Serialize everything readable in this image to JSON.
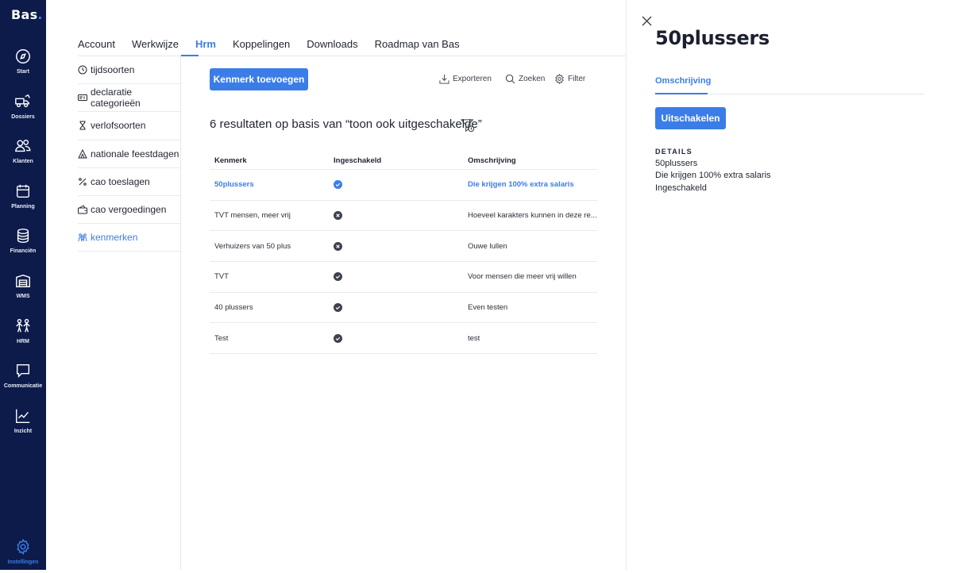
{
  "app": {
    "logo_text": "Bas",
    "logo_dot": ".",
    "accent_color": "#3b7de8",
    "rail_color": "#0c1b4a"
  },
  "rail": {
    "items": [
      {
        "label": "Start",
        "icon": "compass-icon"
      },
      {
        "label": "Dossiers",
        "icon": "truck-icon"
      },
      {
        "label": "Klanten",
        "icon": "users-icon"
      },
      {
        "label": "Planning",
        "icon": "calendar-icon"
      },
      {
        "label": "Financiën",
        "icon": "coins-icon"
      },
      {
        "label": "WMS",
        "icon": "warehouse-icon"
      },
      {
        "label": "HRM",
        "icon": "people-icon"
      },
      {
        "label": "Communicatie",
        "icon": "chat-icon"
      },
      {
        "label": "Inzicht",
        "icon": "chart-icon"
      }
    ],
    "settings_label": "Instellingen"
  },
  "tabs": {
    "items": [
      "Account",
      "Werkwijze",
      "Hrm",
      "Koppelingen",
      "Downloads",
      "Roadmap van Bas"
    ],
    "active": "Hrm"
  },
  "subnav": {
    "items": [
      {
        "label": "tijdsoorten",
        "icon": "clock-icon"
      },
      {
        "label": "declaratie categorieën",
        "icon": "receipt-icon"
      },
      {
        "label": "verlofsoorten",
        "icon": "hourglass-icon"
      },
      {
        "label": "nationale feestdagen",
        "icon": "tent-icon"
      },
      {
        "label": "cao toeslagen",
        "icon": "percent-icon"
      },
      {
        "label": "cao vergoedingen",
        "icon": "wallet-icon"
      },
      {
        "label": "kenmerken",
        "icon": "group-icon"
      }
    ],
    "active": "kenmerken"
  },
  "toolbar": {
    "add_button": "Kenmerk toevoegen",
    "export": "Exporteren",
    "search": "Zoeken",
    "filter": "Filter"
  },
  "results_title": "6 resultaten op basis van “toon ook uitgeschakelde”",
  "table": {
    "headers": [
      "Kenmerk",
      "Ingeschakeld",
      "Omschrijving"
    ],
    "rows": [
      {
        "kenmerk": "50plussers",
        "status": "enabled-selected",
        "omschrijving": "Die krijgen 100% extra salaris"
      },
      {
        "kenmerk": "TVT mensen, meer vrij",
        "status": "disabled",
        "omschrijving": "Hoeveel karakters kunnen in deze re..."
      },
      {
        "kenmerk": "Verhuizers van 50 plus",
        "status": "disabled",
        "omschrijving": "Ouwe lullen"
      },
      {
        "kenmerk": "TVT",
        "status": "enabled",
        "omschrijving": "Voor mensen die meer vrij willen"
      },
      {
        "kenmerk": "40 plussers",
        "status": "enabled",
        "omschrijving": "Even testen"
      },
      {
        "kenmerk": "Test",
        "status": "enabled",
        "omschrijving": "test"
      }
    ]
  },
  "panel": {
    "title": "50plussers",
    "tab": "Omschrijving",
    "button": "Uitschakelen",
    "details_heading": "DETAILS",
    "details": [
      "50plussers",
      "Die krijgen 100% extra salaris",
      "Ingeschakeld"
    ]
  }
}
